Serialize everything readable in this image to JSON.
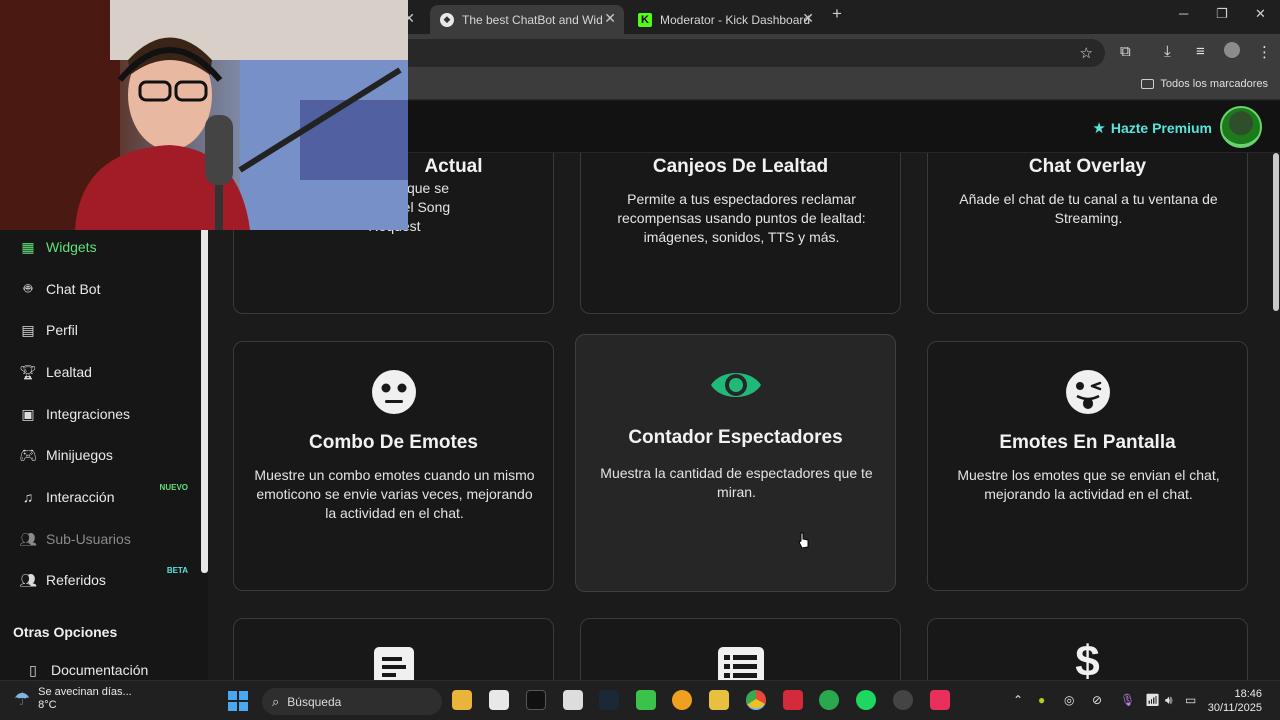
{
  "browser": {
    "tabs": [
      {
        "title": "The best ChatBot and Widgets",
        "active": true
      },
      {
        "title": "Moderator - Kick Dashboard",
        "active": false
      }
    ],
    "bookmarks_all": "Todos los marcadores"
  },
  "header": {
    "premium_label": "Hazte Premium"
  },
  "sidebar": {
    "items": [
      {
        "label": "Widgets",
        "icon": "grid-icon",
        "state": "active"
      },
      {
        "label": "Chat Bot",
        "icon": "robot-icon"
      },
      {
        "label": "Perfil",
        "icon": "id-card-icon"
      },
      {
        "label": "Lealtad",
        "icon": "trophy-icon"
      },
      {
        "label": "Integraciones",
        "icon": "discord-icon"
      },
      {
        "label": "Minijuegos",
        "icon": "gamepad-icon"
      },
      {
        "label": "Interacción",
        "icon": "music-icon",
        "badge": "NUEVO"
      },
      {
        "label": "Sub-Usuarios",
        "icon": "users-icon",
        "state": "disabled"
      },
      {
        "label": "Referidos",
        "icon": "users-icon",
        "badge": "BETA"
      }
    ],
    "section_title": "Otras Opciones",
    "section_items": [
      {
        "label": "Documentación"
      }
    ]
  },
  "cards": [
    {
      "title": "Actual",
      "desc": "la canción que se\nn la cola del Song\nRequest"
    },
    {
      "title": "Canjeos De Lealtad",
      "desc": "Permite a tus espectadores reclamar recompensas usando puntos de lealtad: imágenes, sonidos, TTS y más."
    },
    {
      "title": "Chat Overlay",
      "desc": "Añade el chat de tu canal a tu ventana de Streaming."
    },
    {
      "title": "Combo De Emotes",
      "desc": "Muestre un combo emotes cuando un mismo emoticono se envie varias veces, mejorando la actividad en el chat.",
      "icon": "flat-face-icon"
    },
    {
      "title": "Contador Espectadores",
      "desc": "Muestra la cantidad de espectadores que te miran.",
      "icon": "eye-icon"
    },
    {
      "title": "Emotes En Pantalla",
      "desc": "Muestre los emotes que se envian el chat, mejorando la actividad en el chat.",
      "icon": "tongue-face-icon"
    },
    {
      "icon": "text-align-icon"
    },
    {
      "icon": "list-icon"
    },
    {
      "icon": "dollar-icon"
    }
  ],
  "taskbar": {
    "weather_text": "Se avecinan días...",
    "weather_temp": "8°C",
    "search_placeholder": "Búsqueda",
    "time": "18:46",
    "date": "30/11/2025"
  },
  "colors": {
    "accent_green": "#5fe07a",
    "premium_cyan": "#56e4dc",
    "eye_green": "#1fb978"
  }
}
